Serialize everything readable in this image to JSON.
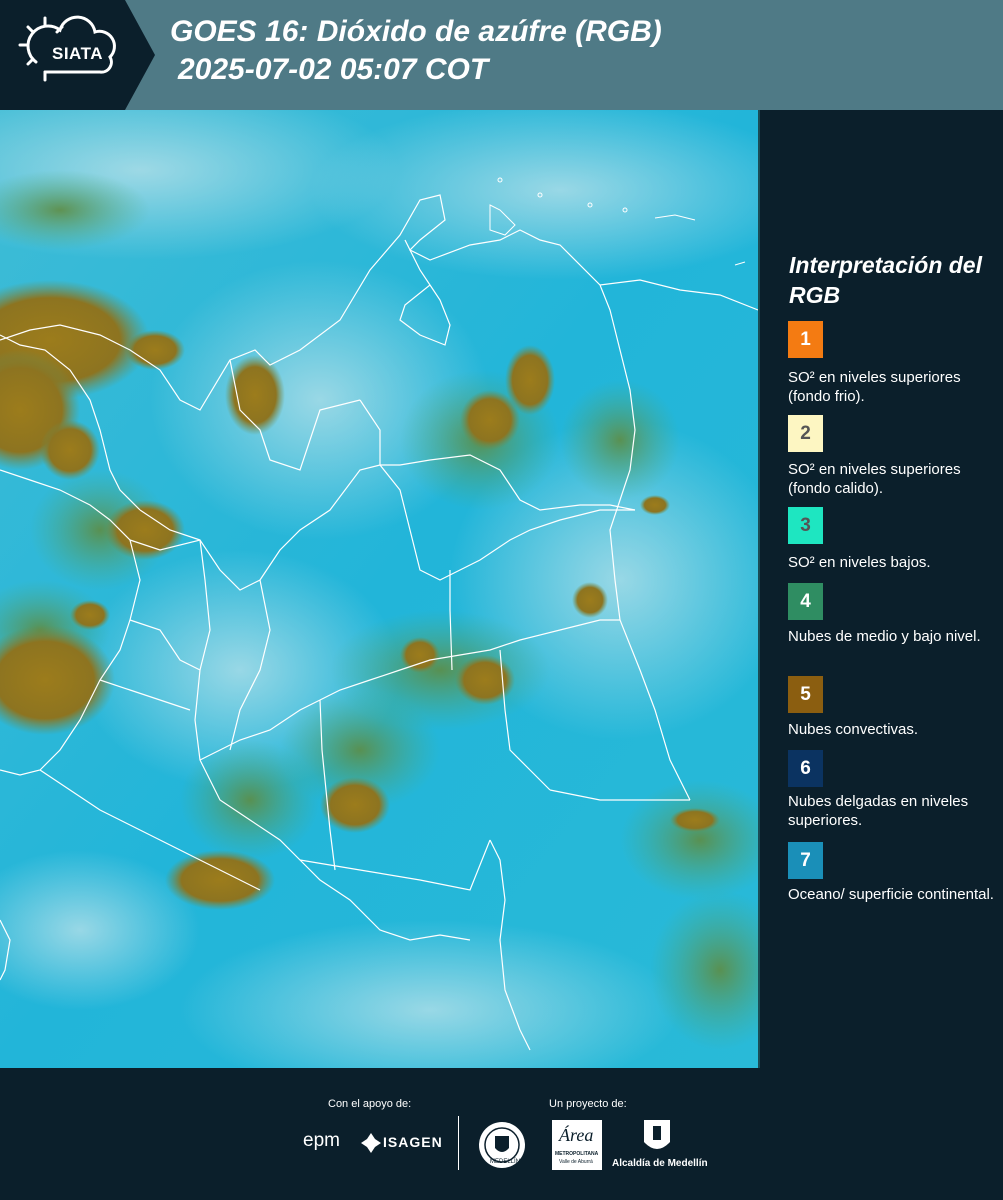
{
  "header": {
    "logo_text": "SIATA",
    "title": "GOES 16: Dióxido de azúfre (RGB)",
    "subtitle": "2025-07-02 05:07 COT"
  },
  "legend": {
    "title": "Interpretación del RGB",
    "items": [
      {
        "number": "1",
        "label": "SO² en niveles superiores (fondo frio).",
        "color": "#f47b12",
        "text_color": "#ffffff"
      },
      {
        "number": "2",
        "label": "SO² en niveles superiores (fondo calido).",
        "color": "#fdf6c2",
        "text_color": "#555555"
      },
      {
        "number": "3",
        "label": "SO² en niveles bajos.",
        "color": "#1ee6c1",
        "text_color": "#555555"
      },
      {
        "number": "4",
        "label": "Nubes de medio y bajo nivel.",
        "color": "#2f8d62",
        "text_color": "#ffffff"
      },
      {
        "number": "5",
        "label": "Nubes convectivas.",
        "color": "#8b5e10",
        "text_color": "#ffffff"
      },
      {
        "number": "6",
        "label": "Nubes delgadas en niveles superiores.",
        "color": "#0b3361",
        "text_color": "#ffffff"
      },
      {
        "number": "7",
        "label": "Oceano/ superficie continental.",
        "color": "#1a8fb8",
        "text_color": "#ffffff"
      }
    ]
  },
  "footer": {
    "support_label": "Con el apoyo de:",
    "project_label": "Un proyecto de:",
    "epm": "epm",
    "isagen": "ISAGEN",
    "medellin_seal": "MEDELLÍN",
    "area_name": "Área",
    "area_sub1": "METROPOLITANA",
    "area_sub2": "Valle de Aburrá",
    "alcaldia": "Alcaldía de Medellín"
  }
}
